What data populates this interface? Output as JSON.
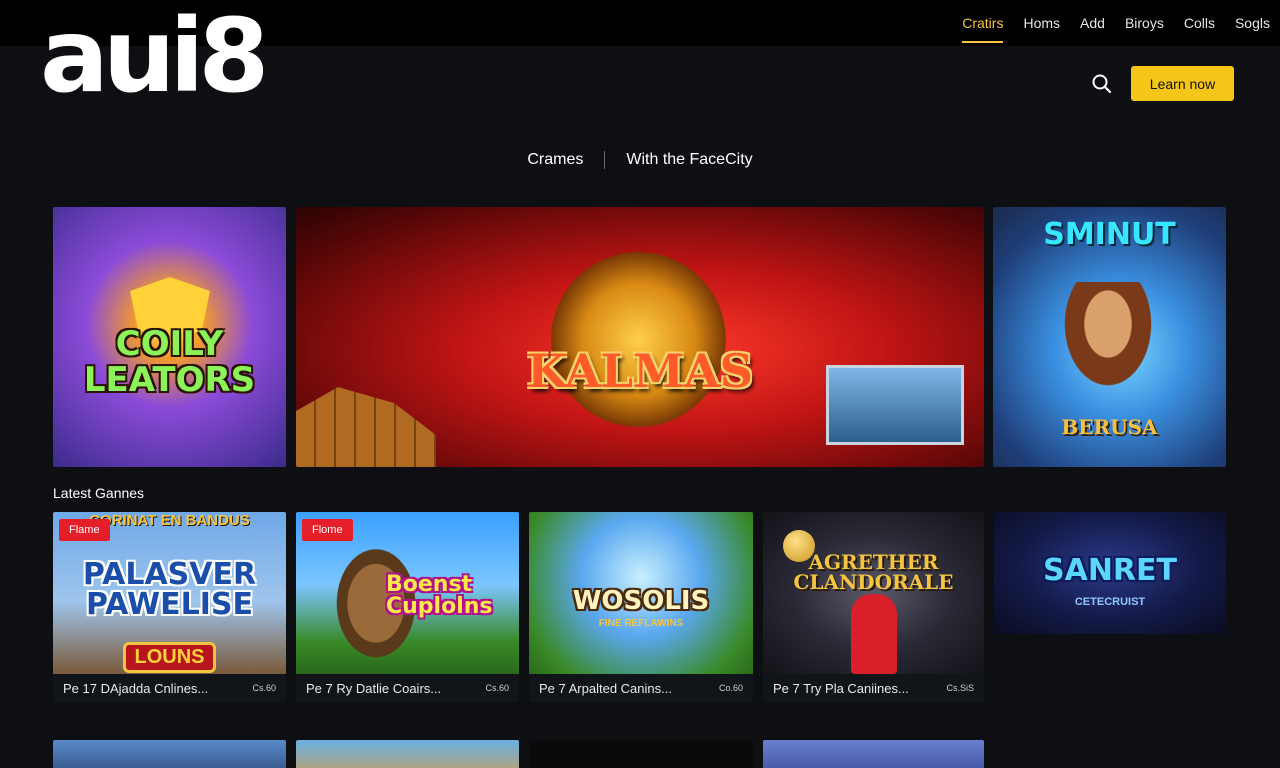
{
  "brand": {
    "logo": "aui8",
    "accent": "#f5c518"
  },
  "topnav": [
    {
      "label": "Cratirs",
      "active": true
    },
    {
      "label": "Homs"
    },
    {
      "label": "Add"
    },
    {
      "label": "Biroys"
    },
    {
      "label": "Colls"
    },
    {
      "label": "Sogls"
    }
  ],
  "header": {
    "cta_label": "Learn now",
    "search_icon": "search-icon"
  },
  "subnav": {
    "left": "Crames",
    "right": "With the FaceCity"
  },
  "hero": {
    "left": {
      "title": "COILY LEATORS"
    },
    "main": {
      "title": "KALMAS"
    },
    "right": {
      "title": "SMINUT",
      "subtitle": "BERUSA"
    }
  },
  "latest": {
    "title": "Latest Gannes",
    "cards": [
      {
        "badge": "Flame",
        "art_top": "CORINAT EN BANDUS",
        "art_title": "PALASVER PAWELISE",
        "art_bottom": "LOUNS",
        "caption": "Pe 17 DAjadda Cnlines...",
        "meta": "Cs.60"
      },
      {
        "badge": "Flome",
        "art_title": "Boenst Cuplolns",
        "caption": "Pe 7 Ry Datlie Coairs...",
        "meta": "Cs.60"
      },
      {
        "art_title": "WOSOLIS",
        "art_sub": "FINE REFLAWINS",
        "caption": "Pe 7 Arpalted Canins...",
        "meta": "Co.60"
      },
      {
        "art_title": "AGRETHER CLANDORALE",
        "caption": "Pe 7 Try Pla Caniines...",
        "meta": "Cs.SiS"
      },
      {
        "art_title": "SANRET",
        "art_sub": "CETECRUIST"
      }
    ]
  }
}
